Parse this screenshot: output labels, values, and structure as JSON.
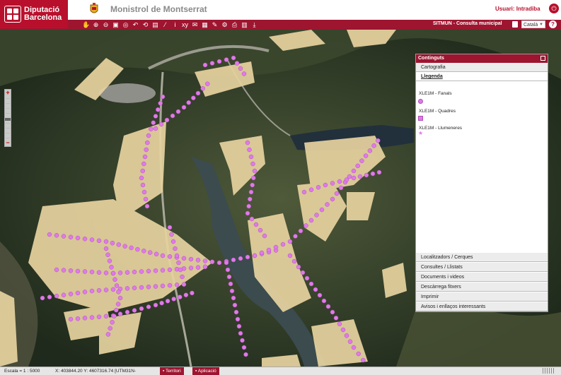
{
  "header": {
    "logo_line1": "Diputació",
    "logo_line2": "Barcelona",
    "municipality": "Monistrol de Montserrat",
    "user_label": "Usuari: Intradiba"
  },
  "toolbar": {
    "tools": [
      {
        "icon": "pan-hand-icon",
        "glyph": "✋"
      },
      {
        "icon": "zoom-in-icon",
        "glyph": "⊕"
      },
      {
        "icon": "zoom-out-icon",
        "glyph": "⊖"
      },
      {
        "icon": "zoom-box-icon",
        "glyph": "▣"
      },
      {
        "icon": "zoom-full-icon",
        "glyph": "◎"
      },
      {
        "icon": "zoom-prev-icon",
        "glyph": "↶"
      },
      {
        "icon": "refresh-icon",
        "glyph": "⟲"
      },
      {
        "icon": "layers-icon",
        "glyph": "▤"
      },
      {
        "icon": "measure-icon",
        "glyph": "⁄"
      },
      {
        "icon": "info-icon",
        "glyph": "i"
      },
      {
        "icon": "coordinates-icon",
        "glyph": "xy"
      },
      {
        "icon": "comment-icon",
        "glyph": "✉"
      },
      {
        "icon": "table-icon",
        "glyph": "▦"
      },
      {
        "icon": "edit-icon",
        "glyph": "✎"
      },
      {
        "icon": "settings-icon",
        "glyph": "⚙"
      },
      {
        "icon": "print-icon",
        "glyph": "⎙"
      },
      {
        "icon": "export-icon",
        "glyph": "▥"
      },
      {
        "icon": "download-icon",
        "glyph": "⤓"
      }
    ],
    "app_label": "SITMUN - Consulta municipal",
    "language": "Català",
    "help_glyph": "?"
  },
  "panel": {
    "title": "Continguts",
    "sections_top": [
      "Cartografia",
      "Llegenda"
    ],
    "active_section": "Llegenda",
    "legend": [
      {
        "label": "XLE1M - Fanals",
        "symbol": "circle",
        "color": "#e07ae8"
      },
      {
        "label": "XLE1M - Quadres",
        "symbol": "square",
        "color": "#e07ae8"
      },
      {
        "label": "XLE1M - Llumeneres",
        "symbol": "star",
        "color": "#e07ae8"
      }
    ],
    "sections_bottom": [
      "Localitzadors / Cerques",
      "Consultes / Llistats",
      "Documents i videos",
      "Descàrrega fitxers",
      "Imprimir",
      "Avisos i enllaços interessants"
    ]
  },
  "map": {
    "zoom_in": "+",
    "zoom_out": "−",
    "point_color": "#e07ae8",
    "building_color": "#e7d3a0"
  },
  "status": {
    "scale": "Escala = 1 : 5000",
    "coords": "X: 403844.20 Y: 4607316.74 [UTM31N-",
    "btn_territori": "Territori",
    "btn_aplicacio": "Aplicació"
  }
}
